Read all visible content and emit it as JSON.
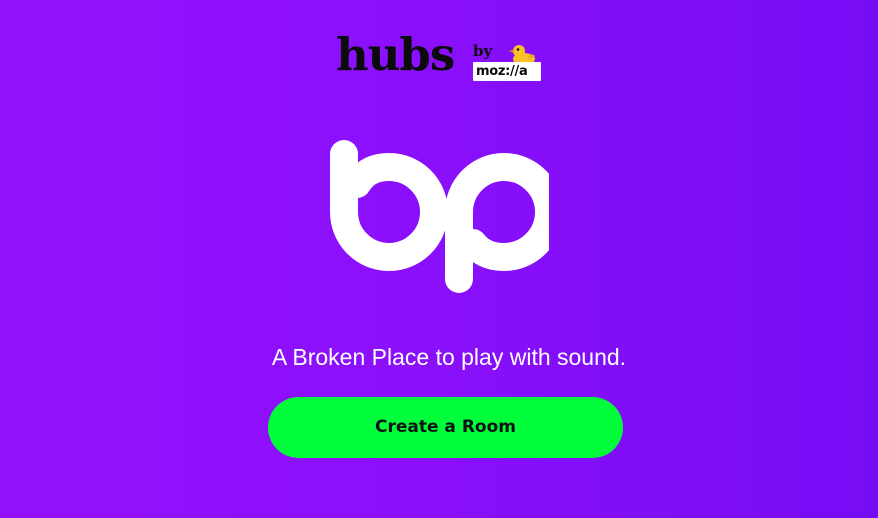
{
  "header": {
    "brand": "hubs",
    "by": "by",
    "maker": "moz://a",
    "mascot_icon": "rubber-duck-icon"
  },
  "hero": {
    "logo_text": "bp",
    "logo_icon": "bp-logo-icon",
    "tagline": "A Broken Place to play with sound."
  },
  "actions": {
    "create_room_label": "Create a Room"
  },
  "colors": {
    "background_start": "#9412fb",
    "background_end": "#760cf5",
    "button": "#00fe3a",
    "logo": "#ffffff",
    "duck": "#f9c227"
  }
}
